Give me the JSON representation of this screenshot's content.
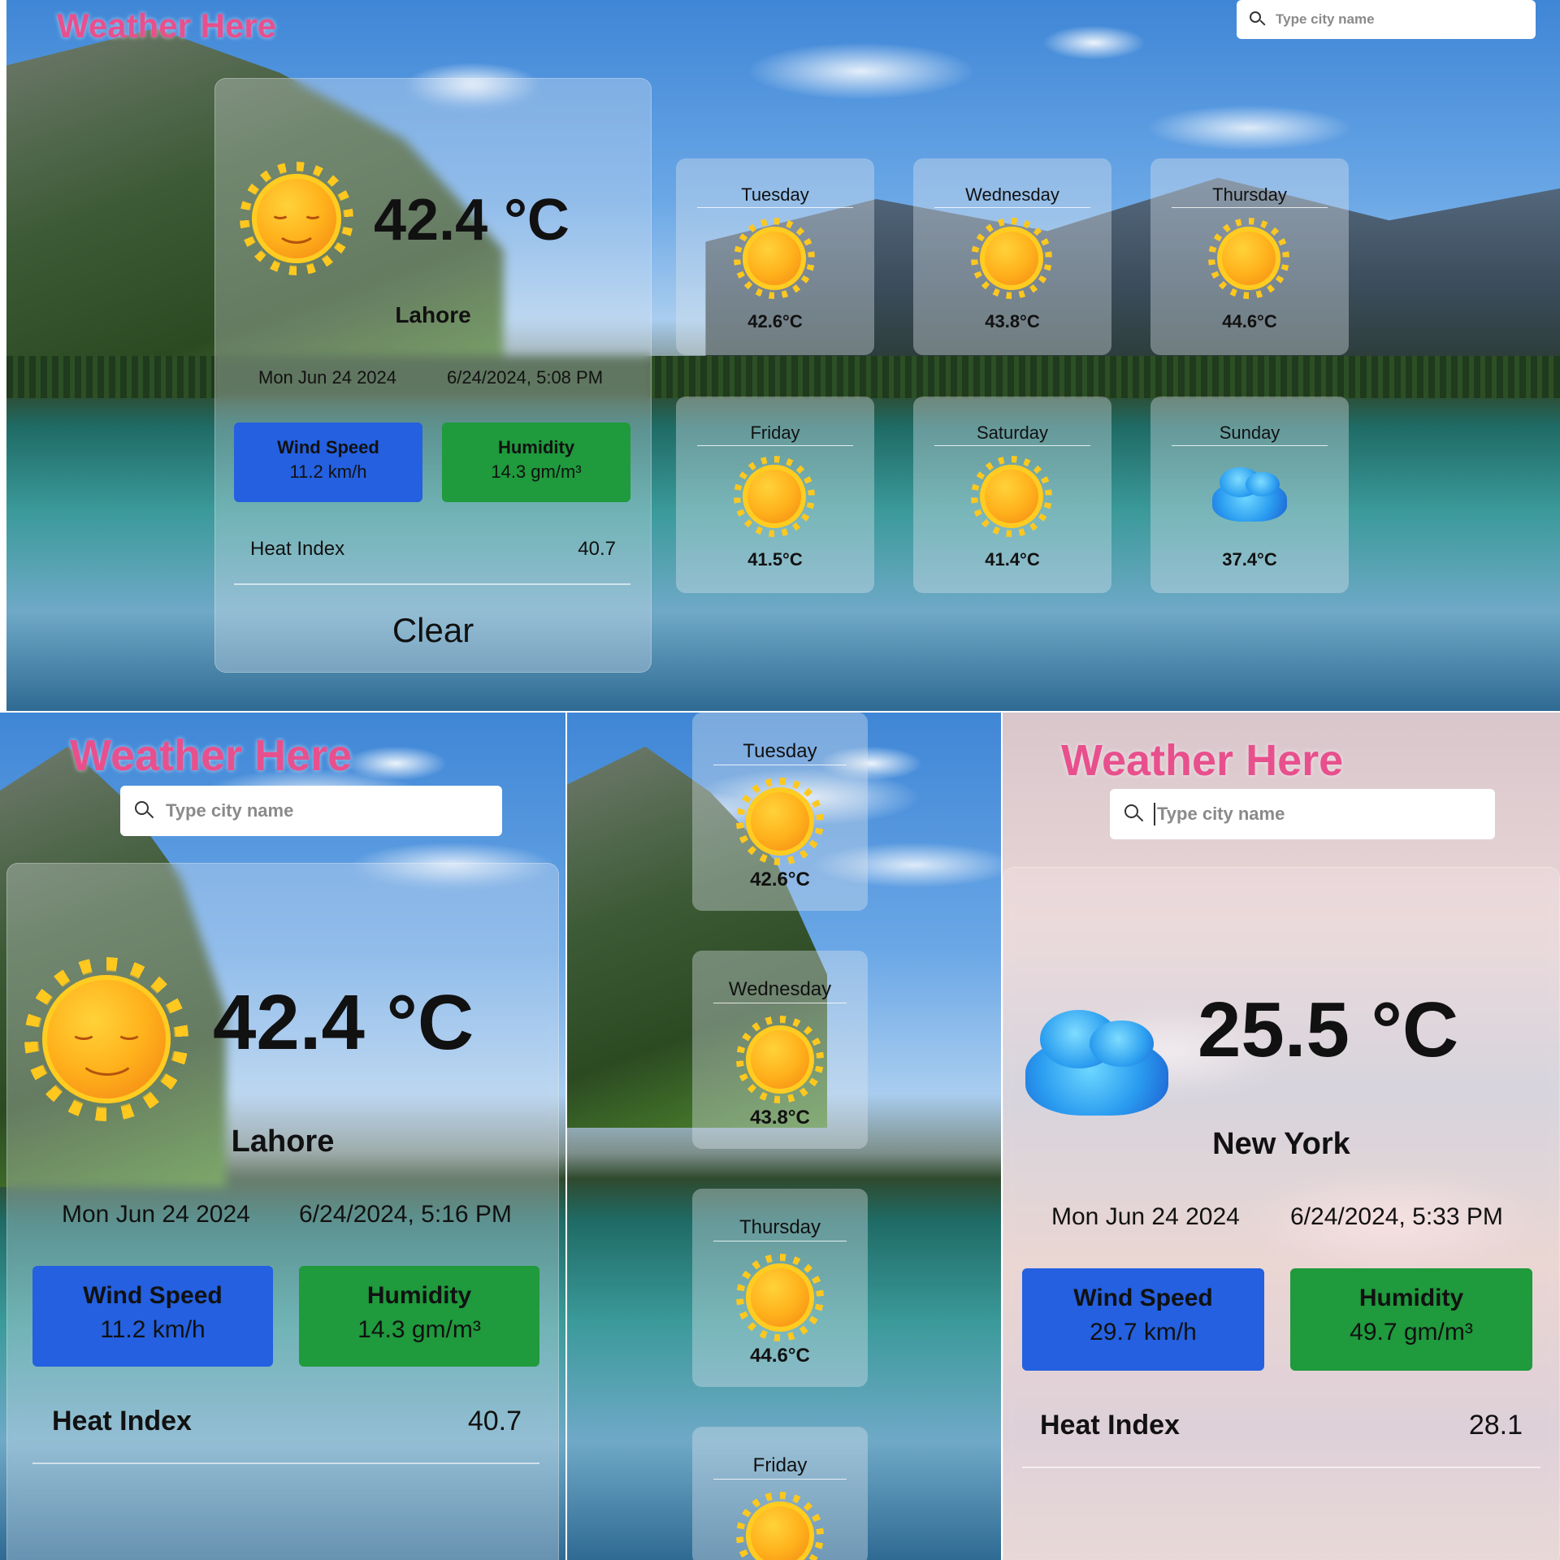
{
  "screens": {
    "desktop": {
      "app_title": "Weather Here",
      "search_placeholder": "Type city name",
      "current": {
        "temperature": "42.4 °C",
        "city": "Lahore",
        "date": "Mon Jun 24 2024",
        "datetime": "6/24/2024, 5:08 PM",
        "wind_label": "Wind Speed",
        "wind_value": "11.2 km/h",
        "humidity_label": "Humidity",
        "humidity_value": "14.3 gm/m³",
        "heat_index_label": "Heat Index",
        "heat_index_value": "40.7",
        "condition": "Clear",
        "icon": "sun-icon"
      },
      "forecast": [
        {
          "day": "Tuesday",
          "temp": "42.6°C",
          "icon": "sun-icon"
        },
        {
          "day": "Wednesday",
          "temp": "43.8°C",
          "icon": "sun-icon"
        },
        {
          "day": "Thursday",
          "temp": "44.6°C",
          "icon": "sun-icon"
        },
        {
          "day": "Friday",
          "temp": "41.5°C",
          "icon": "sun-icon"
        },
        {
          "day": "Saturday",
          "temp": "41.4°C",
          "icon": "sun-icon"
        },
        {
          "day": "Sunday",
          "temp": "37.4°C",
          "icon": "cloud-icon"
        }
      ]
    },
    "mobile_lahore": {
      "app_title": "Weather Here",
      "search_placeholder": "Type city name",
      "current": {
        "temperature": "42.4 °C",
        "city": "Lahore",
        "date": "Mon Jun 24 2024",
        "datetime": "6/24/2024, 5:16 PM",
        "wind_label": "Wind Speed",
        "wind_value": "11.2 km/h",
        "humidity_label": "Humidity",
        "humidity_value": "14.3 gm/m³",
        "heat_index_label": "Heat Index",
        "heat_index_value": "40.7",
        "icon": "sun-icon"
      }
    },
    "mobile_forecast": {
      "forecast": [
        {
          "day": "Tuesday",
          "temp": "42.6°C",
          "icon": "sun-icon"
        },
        {
          "day": "Wednesday",
          "temp": "43.8°C",
          "icon": "sun-icon"
        },
        {
          "day": "Thursday",
          "temp": "44.6°C",
          "icon": "sun-icon"
        },
        {
          "day": "Friday",
          "icon": "sun-icon"
        }
      ]
    },
    "mobile_newyork": {
      "app_title": "Weather Here",
      "search_placeholder": "Type city name",
      "current": {
        "temperature": "25.5 °C",
        "city": "New York",
        "date": "Mon Jun 24 2024",
        "datetime": "6/24/2024, 5:33 PM",
        "wind_label": "Wind Speed",
        "wind_value": "29.7 km/h",
        "humidity_label": "Humidity",
        "humidity_value": "49.7 gm/m³",
        "heat_index_label": "Heat Index",
        "heat_index_value": "28.1",
        "icon": "cloud-icon"
      }
    }
  },
  "colors": {
    "title_pink": "#e8508d",
    "wind_blue": "#2460e0",
    "humidity_green": "#1f9a3d"
  }
}
